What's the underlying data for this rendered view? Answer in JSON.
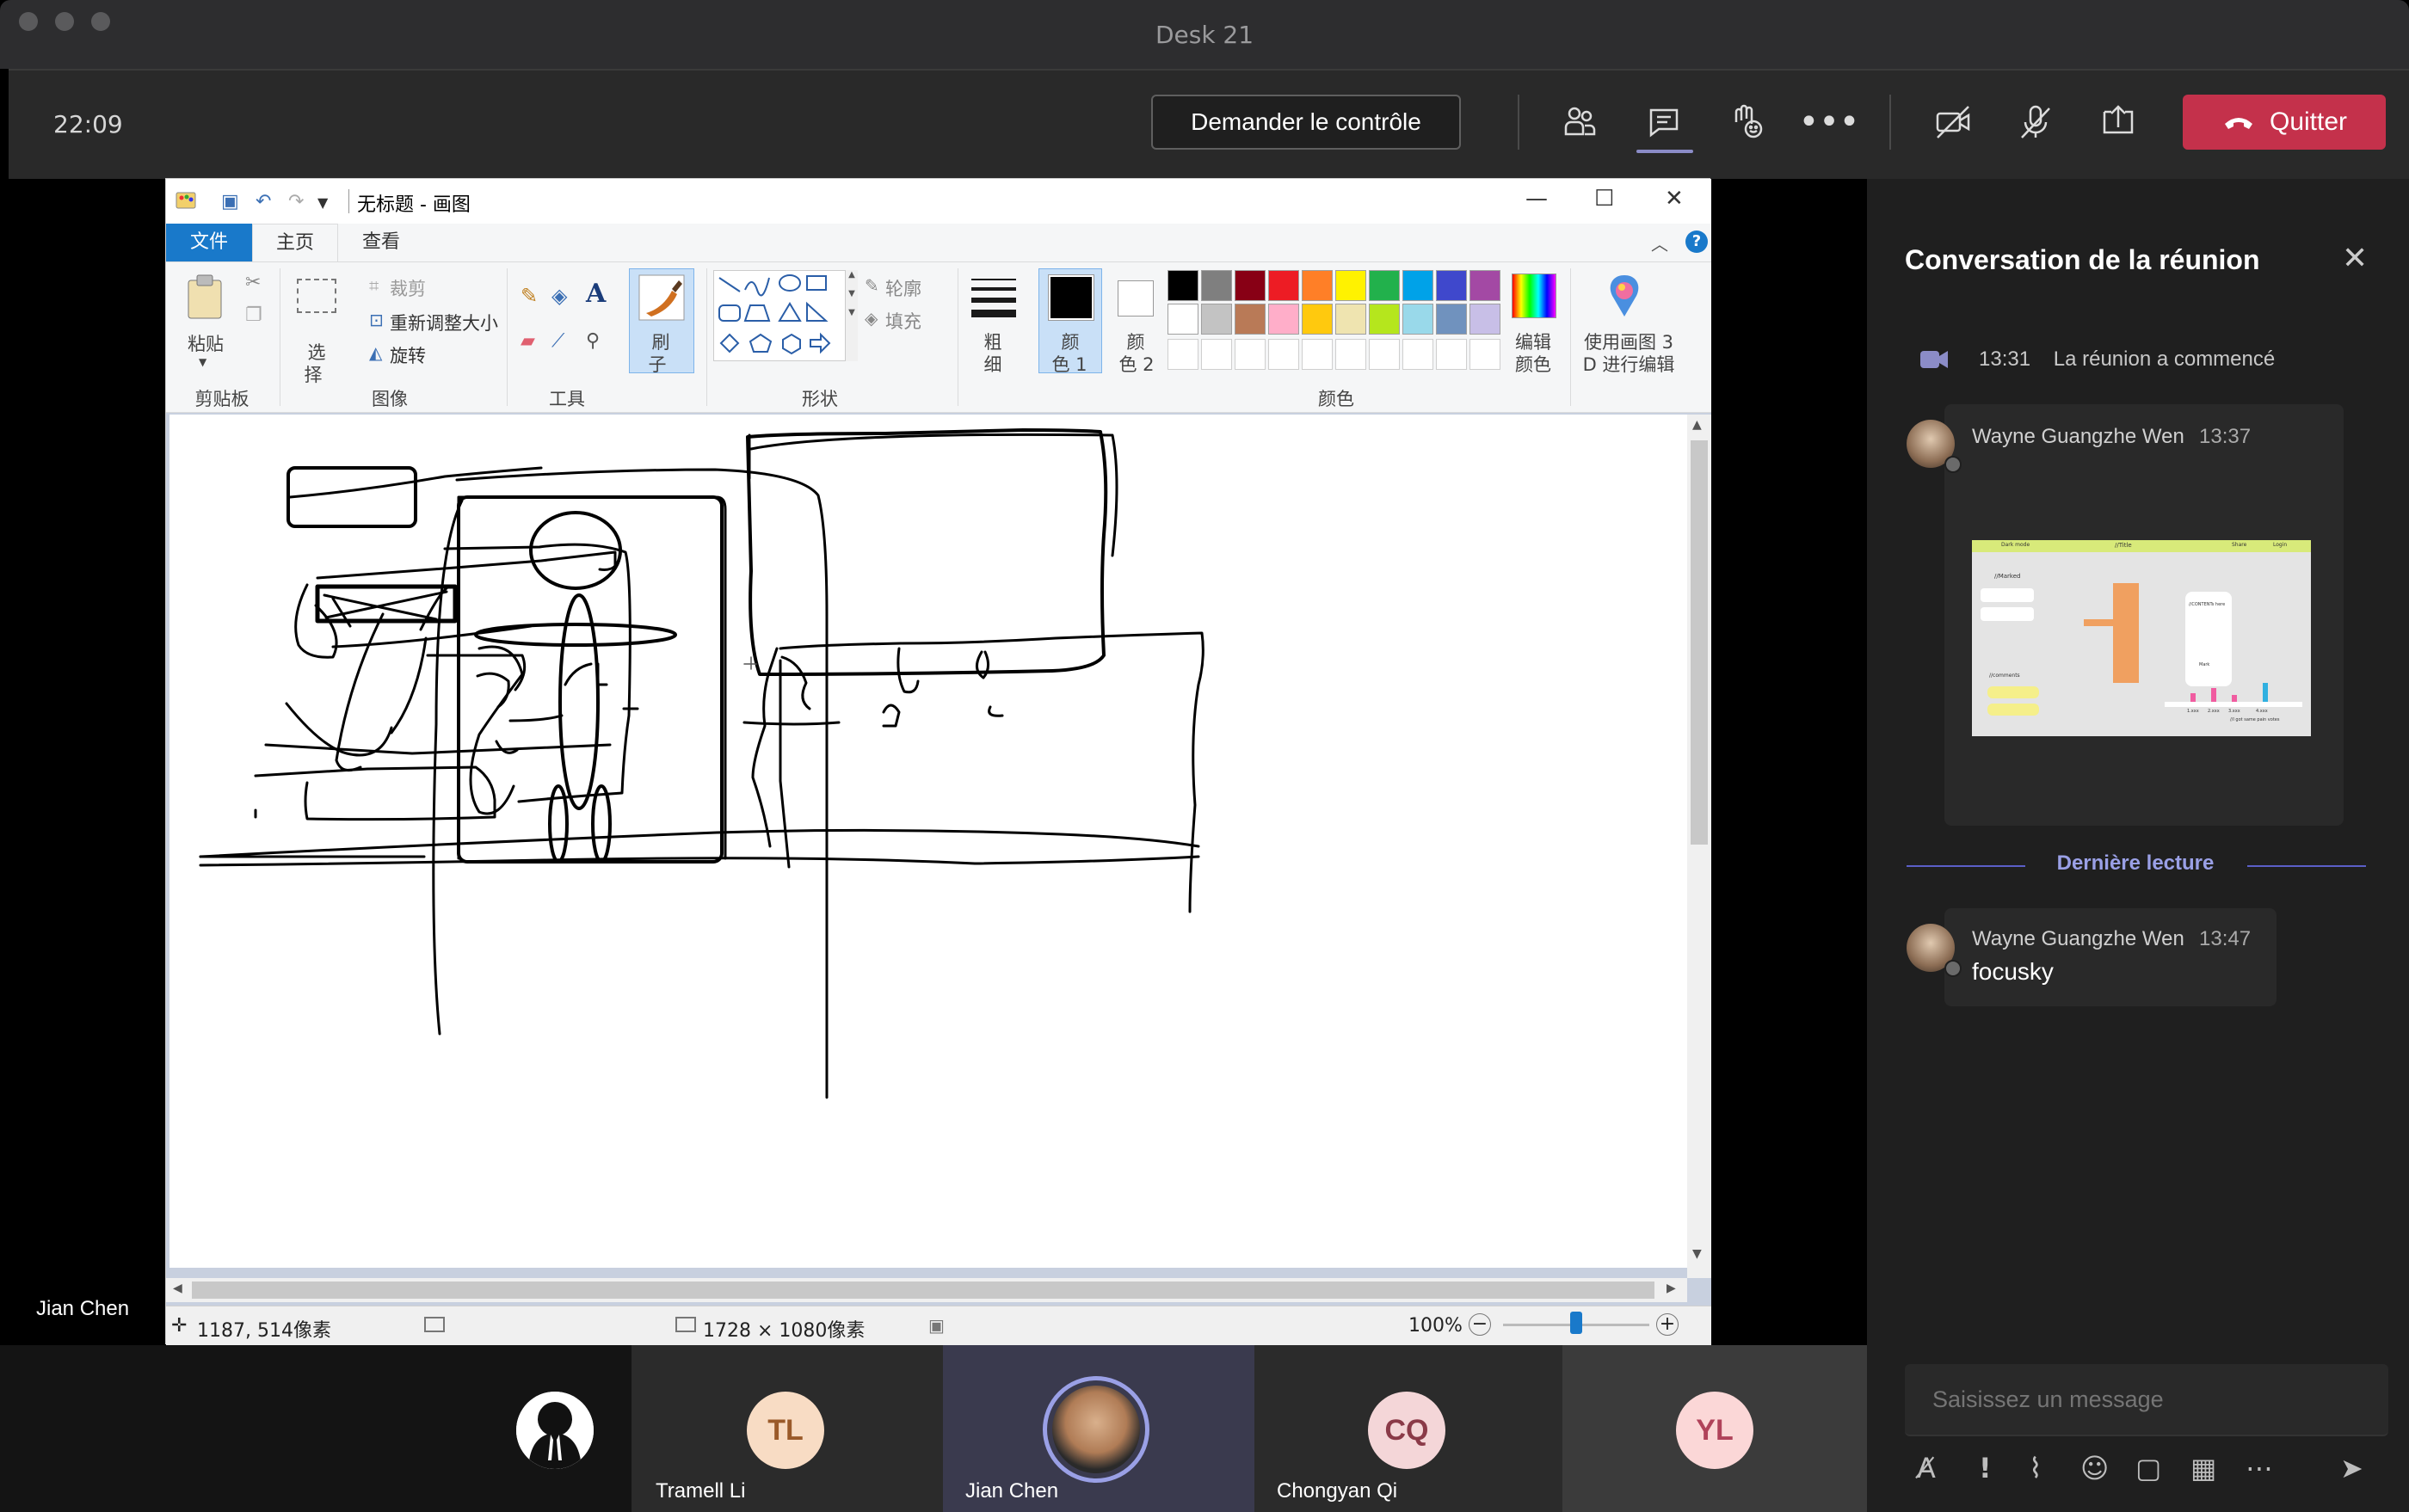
{
  "window": {
    "title": "Desk 21"
  },
  "topbar": {
    "time": "22:09",
    "request_control_label": "Demander le contrôle",
    "quit_label": "Quitter",
    "icons": [
      "participants-icon",
      "chat-icon",
      "raise-hand-icon",
      "more-icon",
      "camera-off-icon",
      "mic-off-icon",
      "share-tray-icon",
      "hang-up-icon"
    ]
  },
  "stage": {
    "presenter_name": "Jian Chen"
  },
  "paint": {
    "title": "无标题 - 画图",
    "tabs": {
      "file": "文件",
      "home": "主页",
      "view": "查看"
    },
    "clipboard": {
      "paste": "粘贴",
      "group": "剪贴板"
    },
    "image": {
      "select_line1": "选",
      "select_line2": "择",
      "crop": "裁剪",
      "resize": "重新调整大小",
      "rotate": "旋转",
      "group": "图像"
    },
    "tools": {
      "group": "工具",
      "text_tool": "A"
    },
    "brush": {
      "line1": "刷",
      "line2": "子"
    },
    "shapes": {
      "outline": "轮廓",
      "fill": "填充",
      "group": "形状"
    },
    "size": {
      "line1": "粗",
      "line2": "细"
    },
    "color1": {
      "line1": "颜",
      "line2": "色 1"
    },
    "color2": {
      "line1": "颜",
      "line2": "色 2"
    },
    "colors_group": "颜色",
    "edit_colors": {
      "line1": "编辑",
      "line2": "颜色"
    },
    "paint3d": {
      "line1": "使用画图 3",
      "line2": "D 进行编辑"
    },
    "palette_row1": [
      "#000000",
      "#7f7f7f",
      "#880015",
      "#ed1c24",
      "#ff7f27",
      "#fff200",
      "#22b14c",
      "#00a2e8",
      "#3f48cc",
      "#a349a4"
    ],
    "palette_row2": [
      "#ffffff",
      "#c3c3c3",
      "#b97a57",
      "#ffaec9",
      "#ffc90e",
      "#efe4b0",
      "#b5e61d",
      "#99d9ea",
      "#7092be",
      "#c8bfe7"
    ],
    "status": {
      "cursor": "1187, 514像素",
      "size": "1728 × 1080像素",
      "zoom": "100%",
      "zoom_level": 0.5
    }
  },
  "chat": {
    "title": "Conversation de la réunion",
    "system_time": "13:31",
    "system_text": "La réunion a commencé",
    "msg1": {
      "sender": "Wayne Guangzhe Wen",
      "time": "13:37"
    },
    "thumb": {
      "t1": "Dark mode",
      "t2": "//Title",
      "t3": "Share",
      "t4": "Login",
      "t5": "//Marked",
      "t6": "//comments",
      "t7": "//CONTENTs here",
      "t8": "Mark",
      "t9": "1.xxx",
      "t10": "2.xxx",
      "t11": "3.xxx",
      "t12": "4.xxx",
      "t13": "//I got same pain votes"
    },
    "last_read": "Dernière lecture",
    "msg2": {
      "sender": "Wayne Guangzhe Wen",
      "time": "13:47",
      "text": "focusky"
    },
    "compose_placeholder": "Saisissez un message"
  },
  "participants": [
    {
      "name": "",
      "initials": ""
    },
    {
      "name": "Tramell Li",
      "initials": "TL"
    },
    {
      "name": "Jian Chen",
      "initials": ""
    },
    {
      "name": "Chongyan Qi",
      "initials": "CQ"
    },
    {
      "name": "",
      "initials": "YL"
    }
  ]
}
